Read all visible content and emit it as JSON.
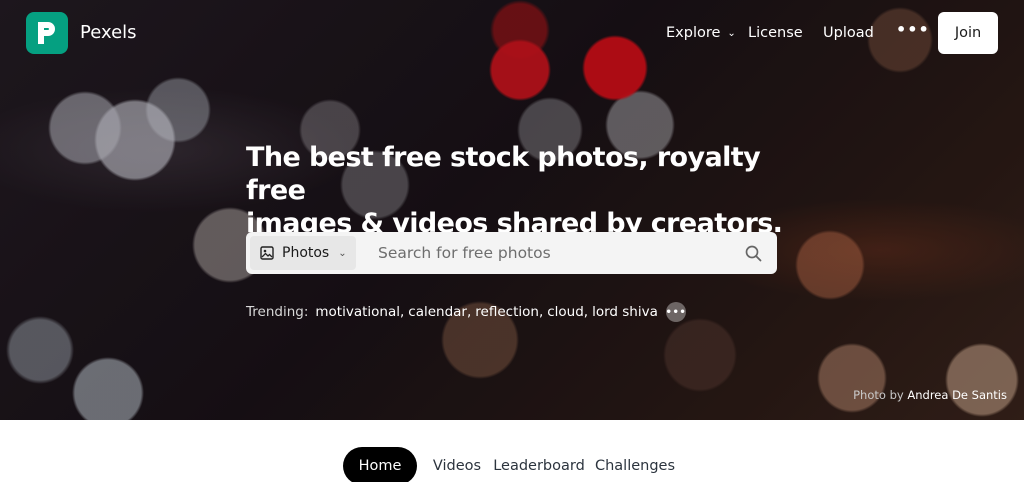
{
  "brand": {
    "name": "Pexels",
    "logo_color": "#05a081"
  },
  "nav": {
    "explore": "Explore",
    "license": "License",
    "upload": "Upload",
    "more": "•••",
    "join": "Join"
  },
  "hero": {
    "headline_line1": "The best free stock photos, royalty free",
    "headline_line2": "images & videos shared by creators."
  },
  "search": {
    "type_label": "Photos",
    "placeholder": "Search for free photos",
    "value": ""
  },
  "trending": {
    "label": "Trending:",
    "items": [
      "motivational",
      "calendar",
      "reflection",
      "cloud",
      "lord shiva"
    ],
    "more": "•••"
  },
  "credit": {
    "prefix": "Photo by",
    "author": "Andrea De Santis"
  },
  "tabs": [
    {
      "label": "Home",
      "active": true
    },
    {
      "label": "Videos",
      "active": false
    },
    {
      "label": "Leaderboard",
      "active": false
    },
    {
      "label": "Challenges",
      "active": false
    }
  ],
  "colors": {
    "accent": "#05a081",
    "tab_active_bg": "#000000"
  }
}
